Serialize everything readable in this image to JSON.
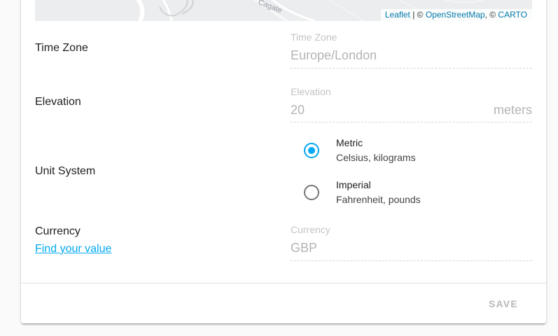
{
  "map": {
    "street_label": "Cagate",
    "attribution": {
      "leaflet": "Leaflet",
      "sep1": " | © ",
      "osm": "OpenStreetMap",
      "sep2": ", © ",
      "carto": "CARTO"
    }
  },
  "time_zone": {
    "row_label": "Time Zone",
    "field_label": "Time Zone",
    "value": "Europe/London"
  },
  "elevation": {
    "row_label": "Elevation",
    "field_label": "Elevation",
    "value": "20",
    "suffix": "meters"
  },
  "unit_system": {
    "row_label": "Unit System",
    "options": [
      {
        "title": "Metric",
        "subtitle": "Celsius, kilograms",
        "selected": true
      },
      {
        "title": "Imperial",
        "subtitle": "Fahrenheit, pounds",
        "selected": false
      }
    ],
    "accent_color": "#03a9f4"
  },
  "currency": {
    "row_label": "Currency",
    "link_text": "Find your value",
    "field_label": "Currency",
    "value": "GBP"
  },
  "actions": {
    "save_label": "SAVE"
  }
}
